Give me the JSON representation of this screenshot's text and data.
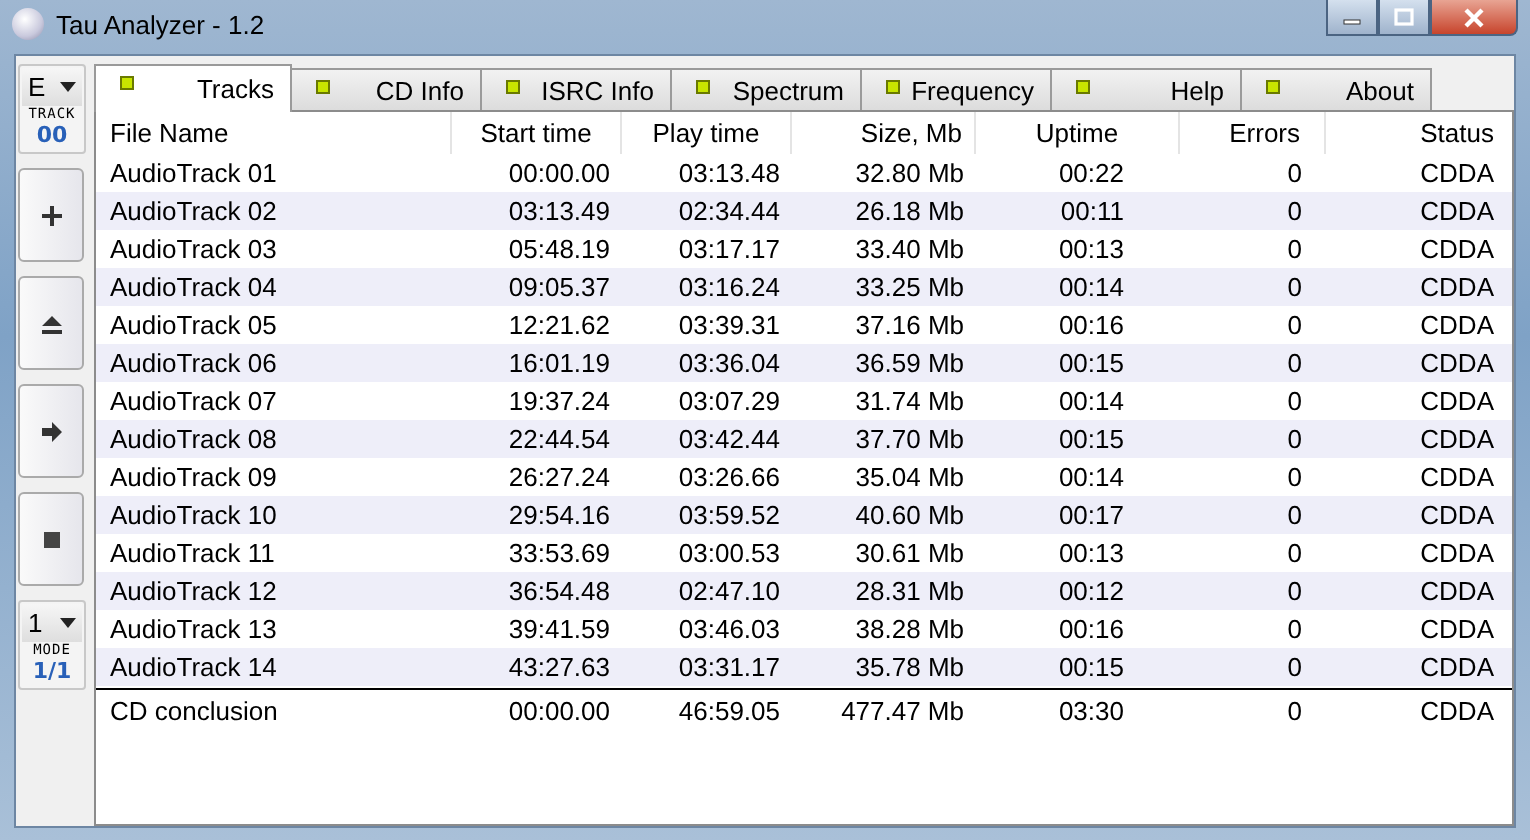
{
  "window": {
    "title": "Tau Analyzer - 1.2"
  },
  "sidebar": {
    "drive": {
      "value": "E",
      "label": "TRACK",
      "reading": "00"
    },
    "buttons": [
      {
        "kind": "add"
      },
      {
        "kind": "eject"
      },
      {
        "kind": "next"
      },
      {
        "kind": "stop"
      }
    ],
    "mode": {
      "value": "1",
      "label": "MODE",
      "reading": "1/1"
    }
  },
  "tabs": [
    {
      "label": "Tracks",
      "selected": true
    },
    {
      "label": "CD Info",
      "selected": false
    },
    {
      "label": "ISRC Info",
      "selected": false
    },
    {
      "label": "Spectrum",
      "selected": false
    },
    {
      "label": "Frequency",
      "selected": false
    },
    {
      "label": "Help",
      "selected": false
    },
    {
      "label": "About",
      "selected": false
    }
  ],
  "table": {
    "columns": [
      "File Name",
      "Start time",
      "Play time",
      "Size, Mb",
      "Uptime",
      "Errors",
      "Status"
    ],
    "rows": [
      [
        "AudioTrack 01",
        "00:00.00",
        "03:13.48",
        "32.80 Mb",
        "00:22",
        "0",
        "CDDA"
      ],
      [
        "AudioTrack 02",
        "03:13.49",
        "02:34.44",
        "26.18 Mb",
        "00:11",
        "0",
        "CDDA"
      ],
      [
        "AudioTrack 03",
        "05:48.19",
        "03:17.17",
        "33.40 Mb",
        "00:13",
        "0",
        "CDDA"
      ],
      [
        "AudioTrack 04",
        "09:05.37",
        "03:16.24",
        "33.25 Mb",
        "00:14",
        "0",
        "CDDA"
      ],
      [
        "AudioTrack 05",
        "12:21.62",
        "03:39.31",
        "37.16 Mb",
        "00:16",
        "0",
        "CDDA"
      ],
      [
        "AudioTrack 06",
        "16:01.19",
        "03:36.04",
        "36.59 Mb",
        "00:15",
        "0",
        "CDDA"
      ],
      [
        "AudioTrack 07",
        "19:37.24",
        "03:07.29",
        "31.74 Mb",
        "00:14",
        "0",
        "CDDA"
      ],
      [
        "AudioTrack 08",
        "22:44.54",
        "03:42.44",
        "37.70 Mb",
        "00:15",
        "0",
        "CDDA"
      ],
      [
        "AudioTrack 09",
        "26:27.24",
        "03:26.66",
        "35.04 Mb",
        "00:14",
        "0",
        "CDDA"
      ],
      [
        "AudioTrack 10",
        "29:54.16",
        "03:59.52",
        "40.60 Mb",
        "00:17",
        "0",
        "CDDA"
      ],
      [
        "AudioTrack 11",
        "33:53.69",
        "03:00.53",
        "30.61 Mb",
        "00:13",
        "0",
        "CDDA"
      ],
      [
        "AudioTrack 12",
        "36:54.48",
        "02:47.10",
        "28.31 Mb",
        "00:12",
        "0",
        "CDDA"
      ],
      [
        "AudioTrack 13",
        "39:41.59",
        "03:46.03",
        "38.28 Mb",
        "00:16",
        "0",
        "CDDA"
      ],
      [
        "AudioTrack 14",
        "43:27.63",
        "03:31.17",
        "35.78 Mb",
        "00:15",
        "0",
        "CDDA"
      ]
    ],
    "summary": [
      "CD conclusion",
      "00:00.00",
      "46:59.05",
      "477.47 Mb",
      "03:30",
      "0",
      "CDDA"
    ]
  }
}
